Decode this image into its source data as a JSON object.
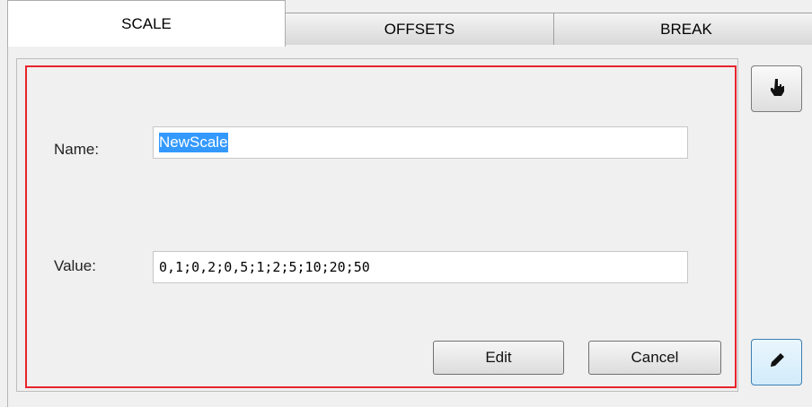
{
  "tabs": [
    {
      "label": "SCALE",
      "active": true
    },
    {
      "label": "OFFSETS",
      "active": false
    },
    {
      "label": "BREAK",
      "active": false
    }
  ],
  "form": {
    "name_label": "Name:",
    "name_value": "NewScale",
    "value_label": "Value:",
    "value_value": "0,1;0,2;0,5;1;2;5;10;20;50"
  },
  "buttons": {
    "edit": "Edit",
    "cancel": "Cancel"
  },
  "side_tools": {
    "top_icon": "hand-pointer-icon",
    "bottom_icon": "pencil-icon"
  },
  "colors": {
    "highlight_border": "#e8232b",
    "selection": "#3399ff"
  }
}
